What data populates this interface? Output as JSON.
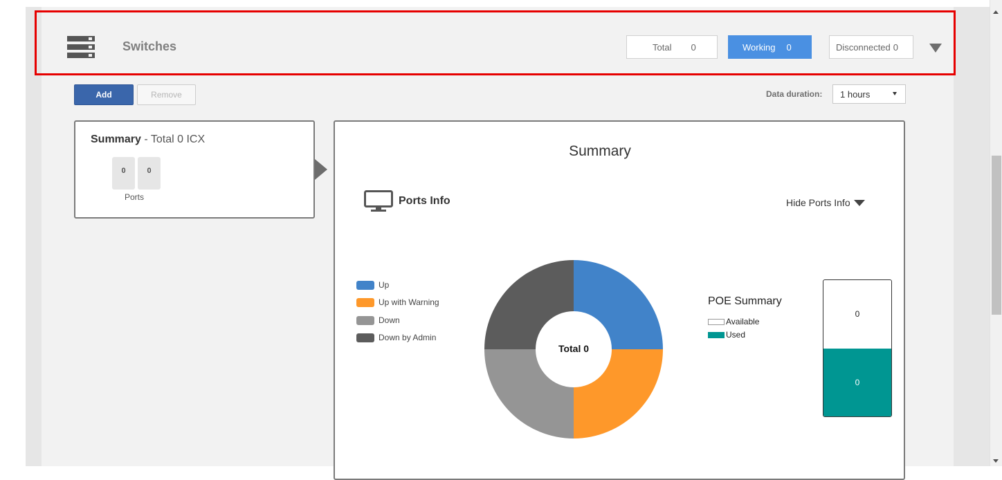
{
  "header": {
    "title": "Switches",
    "total_label": "Total",
    "total_value": "0",
    "working_label": "Working",
    "working_value": "0",
    "disconnected_label": "Disconnected",
    "disconnected_value": "0"
  },
  "toolbar": {
    "add_label": "Add",
    "remove_label": "Remove",
    "duration_label": "Data duration:",
    "duration_value": "1 hours"
  },
  "summary_card": {
    "title_bold": "Summary",
    "title_rest": " - Total 0 ICX",
    "port_values": [
      "0",
      "0"
    ],
    "ports_label": "Ports"
  },
  "main": {
    "title": "Summary",
    "ports_info_label": "Ports Info",
    "hide_ports_label": "Hide Ports Info",
    "legend": [
      {
        "label": "Up",
        "color": "#4183c9"
      },
      {
        "label": "Up with Warning",
        "color": "#fe982a"
      },
      {
        "label": "Down",
        "color": "#959595"
      },
      {
        "label": "Down by Admin",
        "color": "#5c5c5c"
      }
    ],
    "total_label": "Total 0",
    "poe": {
      "title": "POE Summary",
      "available_label": "Available",
      "used_label": "Used",
      "available_value": "0",
      "used_value": "0",
      "used_color": "#009692"
    }
  },
  "chart_data": [
    {
      "type": "pie",
      "categories": [
        "Up",
        "Up with Warning",
        "Down",
        "Down by Admin"
      ],
      "values": [
        0,
        0,
        0,
        0
      ],
      "center_label": "Total 0"
    },
    {
      "type": "bar",
      "title": "POE Summary",
      "categories": [
        "Available",
        "Used"
      ],
      "values": [
        0,
        0
      ]
    }
  ],
  "colors": {
    "working": "#4a90e2",
    "add_button": "#3a66ab",
    "highlight_border": "#e60000"
  }
}
